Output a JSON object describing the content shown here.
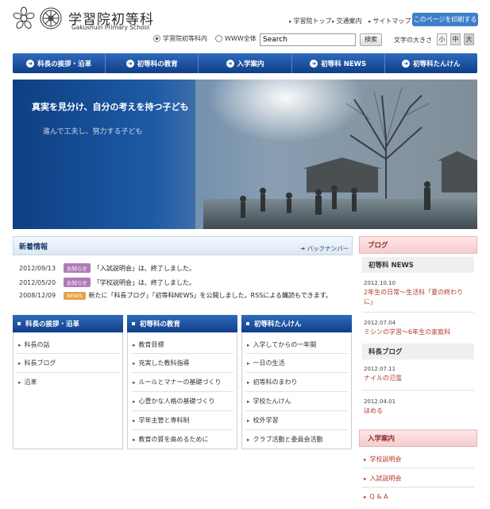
{
  "header": {
    "title": "学習院初等科",
    "subtitle": "Gakushuin Primary School",
    "links": [
      "学習院トップ",
      "交通案内",
      "サイトマップ"
    ],
    "print_button": "このページを印刷する",
    "radio_options": [
      "学習院初等科内",
      "WWW全体"
    ],
    "search_placeholder": "Search",
    "search_button": "検索",
    "font_size_label": "文字の大きさ",
    "font_sizes": [
      "小",
      "中",
      "大"
    ]
  },
  "nav": {
    "items": [
      "科長の挨拶・沿革",
      "初等科の教育",
      "入学案内",
      "初等科 NEWS",
      "初等科たんけん"
    ]
  },
  "hero": {
    "headline": "真実を見分け、自分の考えを持つ子ども",
    "subline": "進んで工夫し、努力する子ども"
  },
  "news": {
    "title": "新着情報",
    "back_link": "バックナンバー",
    "items": [
      {
        "date": "2012/09/13",
        "badge": "お知らせ",
        "text": "「入試説明会」は、終了しました。"
      },
      {
        "date": "2012/05/20",
        "badge": "お知らせ",
        "text": "「学校説明会」は、終了しました。"
      },
      {
        "date": "2008/12/09",
        "badge": "NEWS",
        "text": "新たに「科長ブログ」「初等科NEWS」を公開しました。RSSによる購読もできます。"
      }
    ]
  },
  "columns": [
    {
      "title": "科長の挨拶・沿革",
      "items": [
        "科長の話",
        "科長ブログ",
        "沿革"
      ]
    },
    {
      "title": "初等科の教育",
      "items": [
        "教育目標",
        "充実した教科指導",
        "ルールとマナーの基礎づくり",
        "心豊かな人格の基礎づくり",
        "学年主管と専科制",
        "教育の質を高めるために"
      ]
    },
    {
      "title": "初等科たんけん",
      "items": [
        "入学してからの一年間",
        "一日の生活",
        "初等科のまわり",
        "学校たんけん",
        "校外学習",
        "クラブ活動と委員会活動"
      ]
    }
  ],
  "sidebar": {
    "blog_title": "ブログ",
    "news_title": "初等科 NEWS",
    "news_posts": [
      {
        "date": "2012.10.10",
        "text1": "2年生の日常～生活科「夏の終わり",
        "text2": "に」"
      },
      {
        "date": "2012.07.04",
        "text1": "ミシンの学習～6年生の家庭科",
        "text2": ""
      }
    ],
    "head_blog_title": "科長ブログ",
    "head_posts": [
      {
        "date": "2012.07.11",
        "text1": "ナイルの氾濫"
      },
      {
        "date": "2012.04.01",
        "text1": "ほめる"
      }
    ],
    "admission_title": "入学案内",
    "admission_links": [
      "学校説明会",
      "入試説明会",
      "Q & A"
    ]
  },
  "colors": {
    "nav_blue": "#1d4f9a",
    "accent_red": "#b23a2a",
    "badge_purple": "#b07ab8",
    "badge_orange": "#e8a04a"
  }
}
